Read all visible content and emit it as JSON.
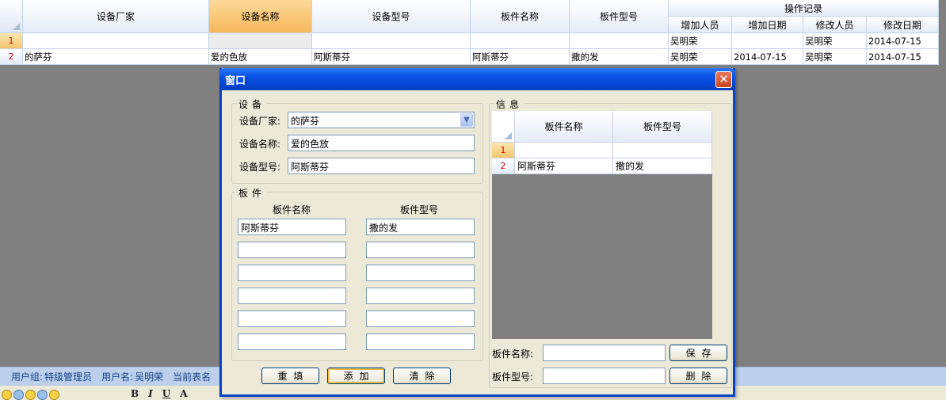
{
  "grid": {
    "columns": [
      "设备厂家",
      "设备名称",
      "设备型号",
      "板件名称",
      "板件型号"
    ],
    "group_header": "操作记录",
    "group_columns": [
      "增加人员",
      "增加日期",
      "修改人员",
      "修改日期"
    ],
    "rows": [
      {
        "num": "1",
        "cells": [
          "",
          "",
          "",
          "",
          "",
          "吴明荣",
          "",
          "吴明荣",
          "2014-07-15"
        ]
      },
      {
        "num": "2",
        "cells": [
          "的萨芬",
          "爱的色放",
          "阿斯蒂芬",
          "阿斯蒂芬",
          "撒的发",
          "吴明荣",
          "2014-07-15",
          "吴明荣",
          "2014-07-15"
        ]
      }
    ]
  },
  "status_bar": {
    "group_label": "用户组:",
    "group_value": "特级管理员",
    "user_label": "用户名:",
    "user_value": "吴明荣",
    "table_label": "当前表名"
  },
  "toolbar": {
    "bold": "B",
    "italic": "I",
    "underline": "U",
    "font_size": "A"
  },
  "dialog": {
    "title": "窗口",
    "close_glyph": "✕",
    "device_section": {
      "legend": "设备",
      "maker_label": "设备厂家:",
      "maker_value": "的萨芬",
      "name_label": "设备名称:",
      "name_value": "爱的色放",
      "model_label": "设备型号:",
      "model_value": "阿斯蒂芬"
    },
    "board_section": {
      "legend": "板件",
      "col_name": "板件名称",
      "col_model": "板件型号",
      "rows": [
        {
          "name": "阿斯蒂芬",
          "model": "撒的发"
        },
        {
          "name": "",
          "model": ""
        },
        {
          "name": "",
          "model": ""
        },
        {
          "name": "",
          "model": ""
        },
        {
          "name": "",
          "model": ""
        },
        {
          "name": "",
          "model": ""
        }
      ]
    },
    "buttons": {
      "reset": "重填",
      "add": "添加",
      "clear": "清除"
    },
    "info_section": {
      "legend": "信息",
      "columns": [
        "板件名称",
        "板件型号"
      ],
      "rows": [
        {
          "num": "1",
          "name": "",
          "model": ""
        },
        {
          "num": "2",
          "name": "阿斯蒂芬",
          "model": "撒的发"
        }
      ],
      "name_label": "板件名称:",
      "model_label": "板件型号:",
      "name_value": "",
      "model_value": "",
      "save": "保存",
      "delete": "删除"
    }
  }
}
